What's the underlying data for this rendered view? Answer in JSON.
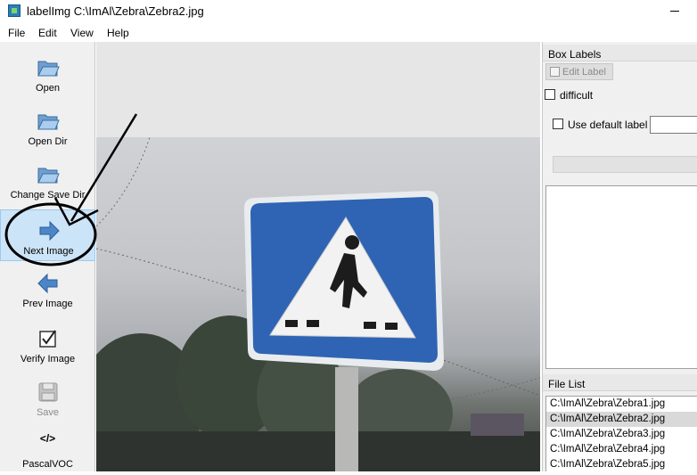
{
  "window": {
    "title": "labelImg C:\\ImAl\\Zebra\\Zebra2.jpg"
  },
  "menu": [
    "File",
    "Edit",
    "View",
    "Help"
  ],
  "toolbar": {
    "open": "Open",
    "open_dir": "Open Dir",
    "change_save_dir": "Change Save Dir",
    "next_image": "Next Image",
    "prev_image": "Prev Image",
    "verify_image": "Verify Image",
    "save": "Save",
    "save_format_glyph": "</>",
    "save_format": "PascalVOC"
  },
  "box_labels": {
    "title": "Box Labels",
    "edit_label": "Edit Label",
    "difficult": "difficult",
    "use_default_label": "Use default label",
    "default_label_value": ""
  },
  "file_list": {
    "title": "File List",
    "items": [
      "C:\\ImAl\\Zebra\\Zebra1.jpg",
      "C:\\ImAl\\Zebra\\Zebra2.jpg",
      "C:\\ImAl\\Zebra\\Zebra3.jpg",
      "C:\\ImAl\\Zebra\\Zebra4.jpg",
      "C:\\ImAl\\Zebra\\Zebra5.jpg"
    ],
    "selected_index": 1
  },
  "colors": {
    "selected_tool": "#cce4f7",
    "sign_blue": "#2f64b4",
    "annotation": "#000000"
  }
}
